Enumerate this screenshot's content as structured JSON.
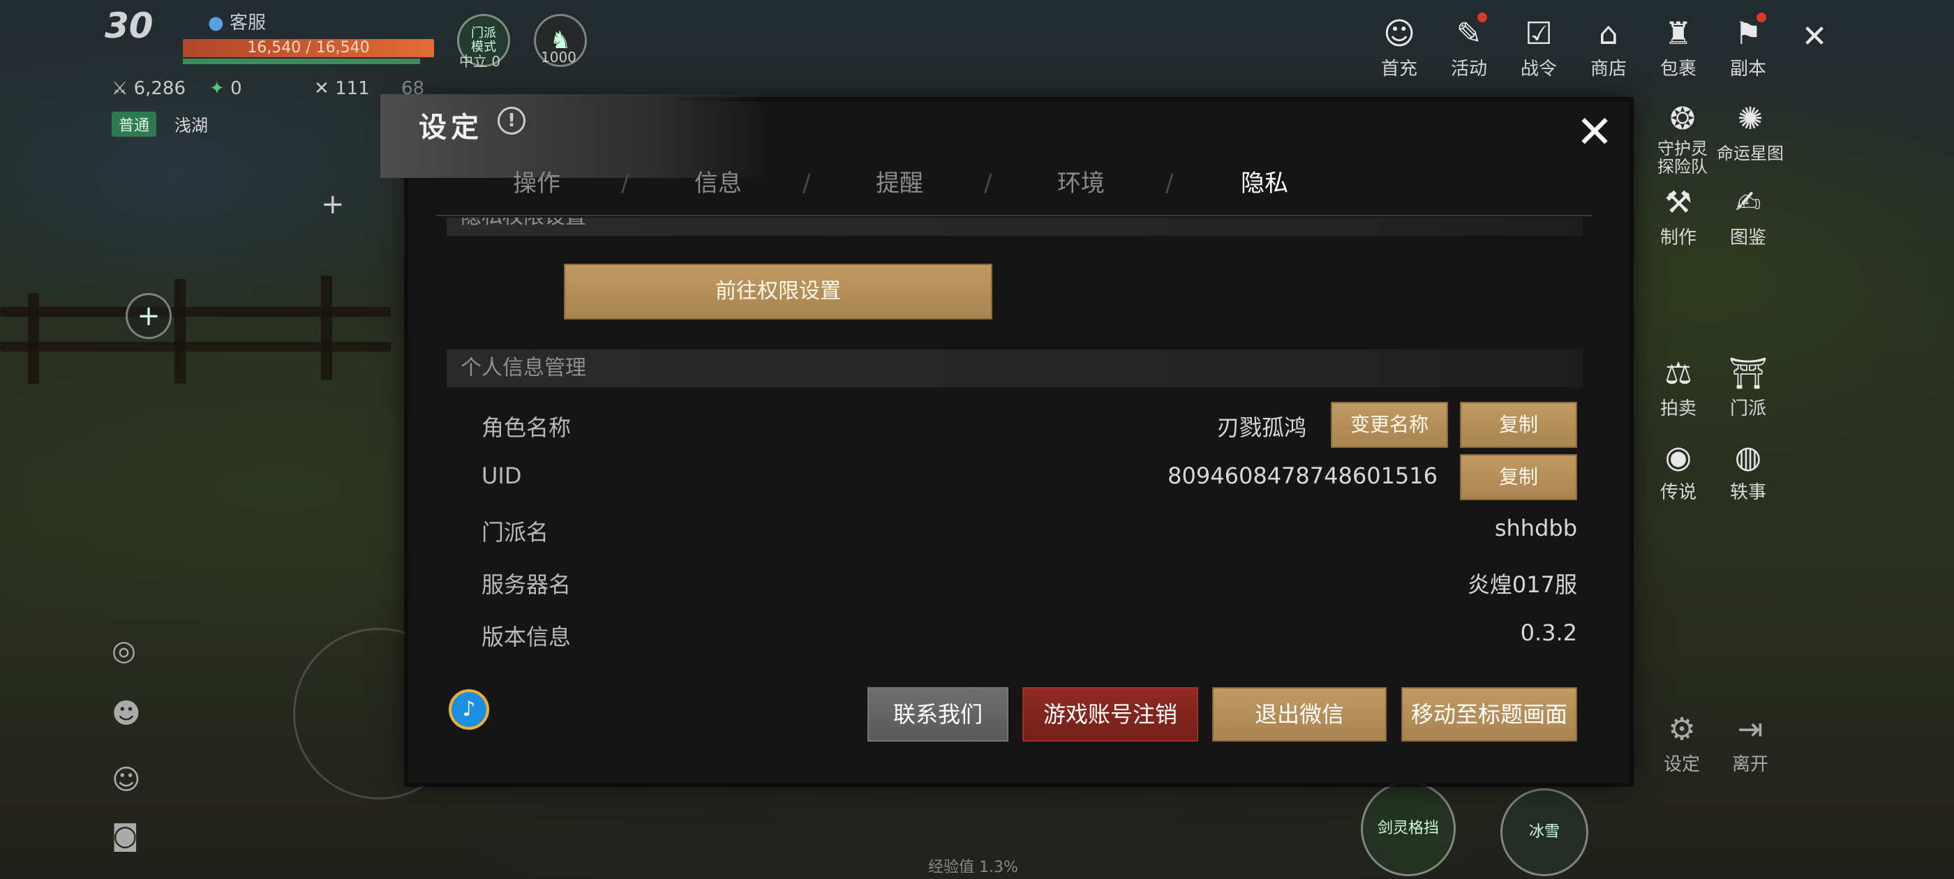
{
  "hud": {
    "level": "30",
    "server": "客服",
    "hp": "16,540 / 16,540",
    "power": "6,286",
    "currency": "0",
    "stat3": "111",
    "stat4": "68",
    "mode_tag": "普通",
    "location": "浅湖",
    "faction_mode": "门派\n模式",
    "faction_neutral": "中立 0",
    "pet_value": "1000",
    "exp": "经验值 1.3%"
  },
  "top_menu": [
    {
      "label": "首充",
      "icon": "portrait-icon"
    },
    {
      "label": "活动",
      "icon": "activity-icon"
    },
    {
      "label": "战令",
      "icon": "battlepass-icon"
    },
    {
      "label": "商店",
      "icon": "shop-icon"
    },
    {
      "label": "包裹",
      "icon": "bag-icon"
    },
    {
      "label": "副本",
      "icon": "dungeon-icon"
    }
  ],
  "side_menu": [
    {
      "label": "守护灵\n探险队",
      "icon": "guardian-icon"
    },
    {
      "label": "命运星图",
      "icon": "starchart-icon"
    },
    {
      "label": "制作",
      "icon": "craft-icon"
    },
    {
      "label": "图鉴",
      "icon": "codex-icon"
    },
    {
      "label": "拍卖",
      "icon": "auction-icon"
    },
    {
      "label": "门派",
      "icon": "sect-icon"
    },
    {
      "label": "传说",
      "icon": "legend-icon"
    },
    {
      "label": "轶事",
      "icon": "anecdote-icon"
    },
    {
      "label": "设定",
      "icon": "settings-icon"
    },
    {
      "label": "离开",
      "icon": "exit-icon"
    }
  ],
  "bottom_skills": [
    {
      "label": "剑灵格挡"
    },
    {
      "label": "冰雪"
    }
  ],
  "dialog": {
    "title": "设定",
    "tabs": [
      "操作",
      "信息",
      "提醒",
      "环境",
      "隐私"
    ],
    "active_tab": "隐私",
    "privacy_section": "隐私权限设置",
    "goto_permissions": "前往权限设置",
    "personal_section": "个人信息管理",
    "rows": {
      "role_name_label": "角色名称",
      "role_name_value": "刃戮孤鸿",
      "rename_btn": "变更名称",
      "copy_btn": "复制",
      "uid_label": "UID",
      "uid_value": "8094608478748601516",
      "sect_label": "门派名",
      "sect_value": "shhdbb",
      "server_label": "服务器名",
      "server_value": "炎煌017服",
      "version_label": "版本信息",
      "version_value": "0.3.2"
    },
    "buttons": {
      "contact": "联系我们",
      "cancel_account": "游戏账号注销",
      "logout_wechat": "退出微信",
      "to_title": "移动至标题画面"
    }
  },
  "colors": {
    "gold_button": "#b38d57",
    "red_button": "#7f241d",
    "grey_button": "#646464",
    "dialog_bg": "#151515"
  }
}
